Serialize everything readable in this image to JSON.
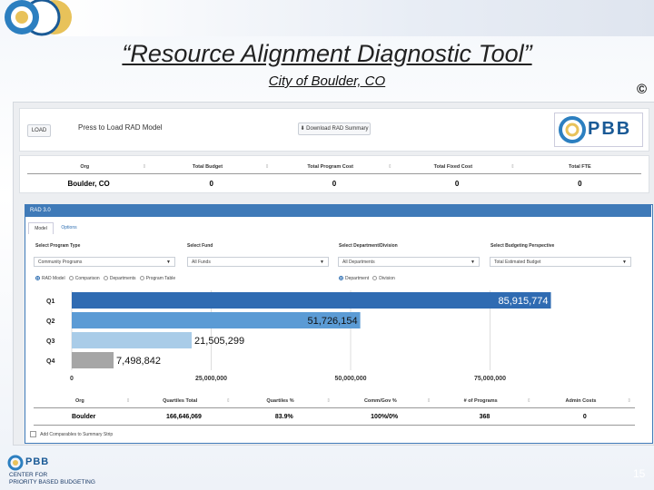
{
  "slide": {
    "title": "“Resource Alignment Diagnostic Tool”",
    "subtitle": "City of Boulder, CO",
    "copyright": "©",
    "page_number": "15",
    "footer_org_line1": "CENTER FOR",
    "footer_org_line2": "PRIORITY BASED BUDGETING",
    "footer_brand": "PBB"
  },
  "toolbar": {
    "load_label": "LOAD",
    "press_to_load": "Press to Load RAD Model",
    "download_label": "Download RAD Summary",
    "brand": "PBB"
  },
  "summary_table": {
    "headers": [
      "Org",
      "Total Budget",
      "Total Program Cost",
      "Total Fixed Cost",
      "Total FTE"
    ],
    "row": [
      "Boulder, CO",
      "0",
      "0",
      "0",
      "0"
    ]
  },
  "panel": {
    "title": "RAD 3.0",
    "tabs": [
      "Model",
      "Options"
    ],
    "fields": [
      {
        "label": "Select Program Type",
        "value": "Community Programs"
      },
      {
        "label": "Select Fund",
        "value": "All Funds"
      },
      {
        "label": "Select Department/Division",
        "value": "All Departments"
      },
      {
        "label": "Select Budgeting Perspective",
        "value": "Total Estimated Budget"
      }
    ],
    "radios_left": [
      "RAD Model",
      "Comparison",
      "Departments",
      "Program Table"
    ],
    "radios_right": [
      "Department",
      "Division"
    ]
  },
  "chart_data": {
    "type": "bar",
    "orientation": "horizontal",
    "categories": [
      "Q1",
      "Q2",
      "Q3",
      "Q4"
    ],
    "values": [
      85915774,
      51726154,
      21505299,
      7498842
    ],
    "value_labels": [
      "85,915,774",
      "51,726,154",
      "21,505,299",
      "7,498,842"
    ],
    "colors": [
      "#2f6bb2",
      "#5b9bd5",
      "#a9cce8",
      "#a6a6a6"
    ],
    "xlim": [
      0,
      100000000
    ],
    "xticks": [
      "0",
      "25,000,000",
      "50,000,000",
      "75,000,000"
    ],
    "xtick_values": [
      0,
      25000000,
      50000000,
      75000000
    ],
    "grid": true
  },
  "quartile_table": {
    "headers": [
      "Org",
      "Quartiles Total",
      "Quartiles %",
      "Comm/Gov %",
      "# of Programs",
      "Admin Costs"
    ],
    "row": [
      "Boulder",
      "166,646,069",
      "83.9%",
      "100%/0%",
      "368",
      "0"
    ]
  },
  "checkbox_label": "Add Comparables to Summary Strip"
}
